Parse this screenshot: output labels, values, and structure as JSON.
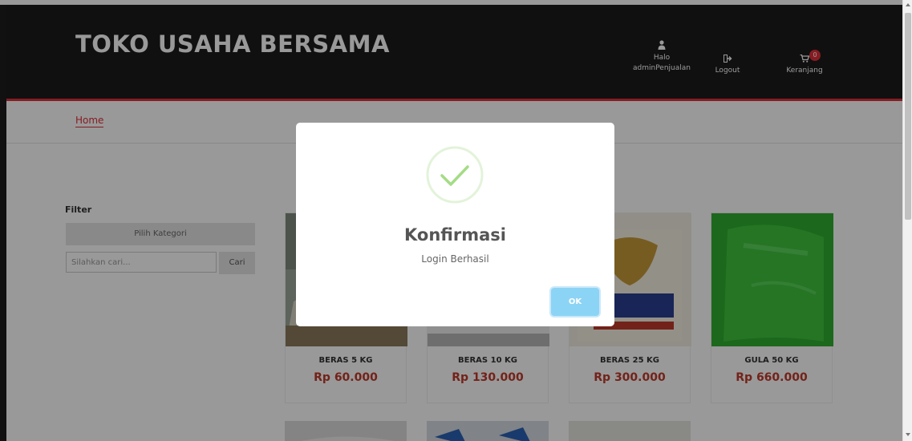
{
  "navbar": {
    "brand": "TOKO USAHA BERSAMA",
    "user_line1": "Halo",
    "user_line2": "adminPenjualan",
    "logout": "Logout",
    "cart": "Keranjang",
    "cart_count": "0"
  },
  "breadcrumb": {
    "home": "Home"
  },
  "filter": {
    "title": "Filter",
    "category_button": "Pilih Kategori",
    "search_placeholder": "Silahkan cari...",
    "search_button": "Cari"
  },
  "products": [
    {
      "name": "BERAS 5 KG",
      "price": "Rp 60.000"
    },
    {
      "name": "BERAS 10 KG",
      "price": "Rp 130.000"
    },
    {
      "name": "BERAS 25 KG",
      "price": "Rp 300.000"
    },
    {
      "name": "GULA 50 KG",
      "price": "Rp 660.000"
    }
  ],
  "modal": {
    "title": "Konfirmasi",
    "message": "Login Berhasil",
    "ok": "OK"
  },
  "colors": {
    "accent": "#e0303a",
    "navbar": "#1b1b1b",
    "price": "#c0392b",
    "ok_button": "#8cd4f5",
    "success": "#a5dc86"
  },
  "icons": [
    "user-icon",
    "logout-icon",
    "cart-icon",
    "success-check-icon"
  ]
}
